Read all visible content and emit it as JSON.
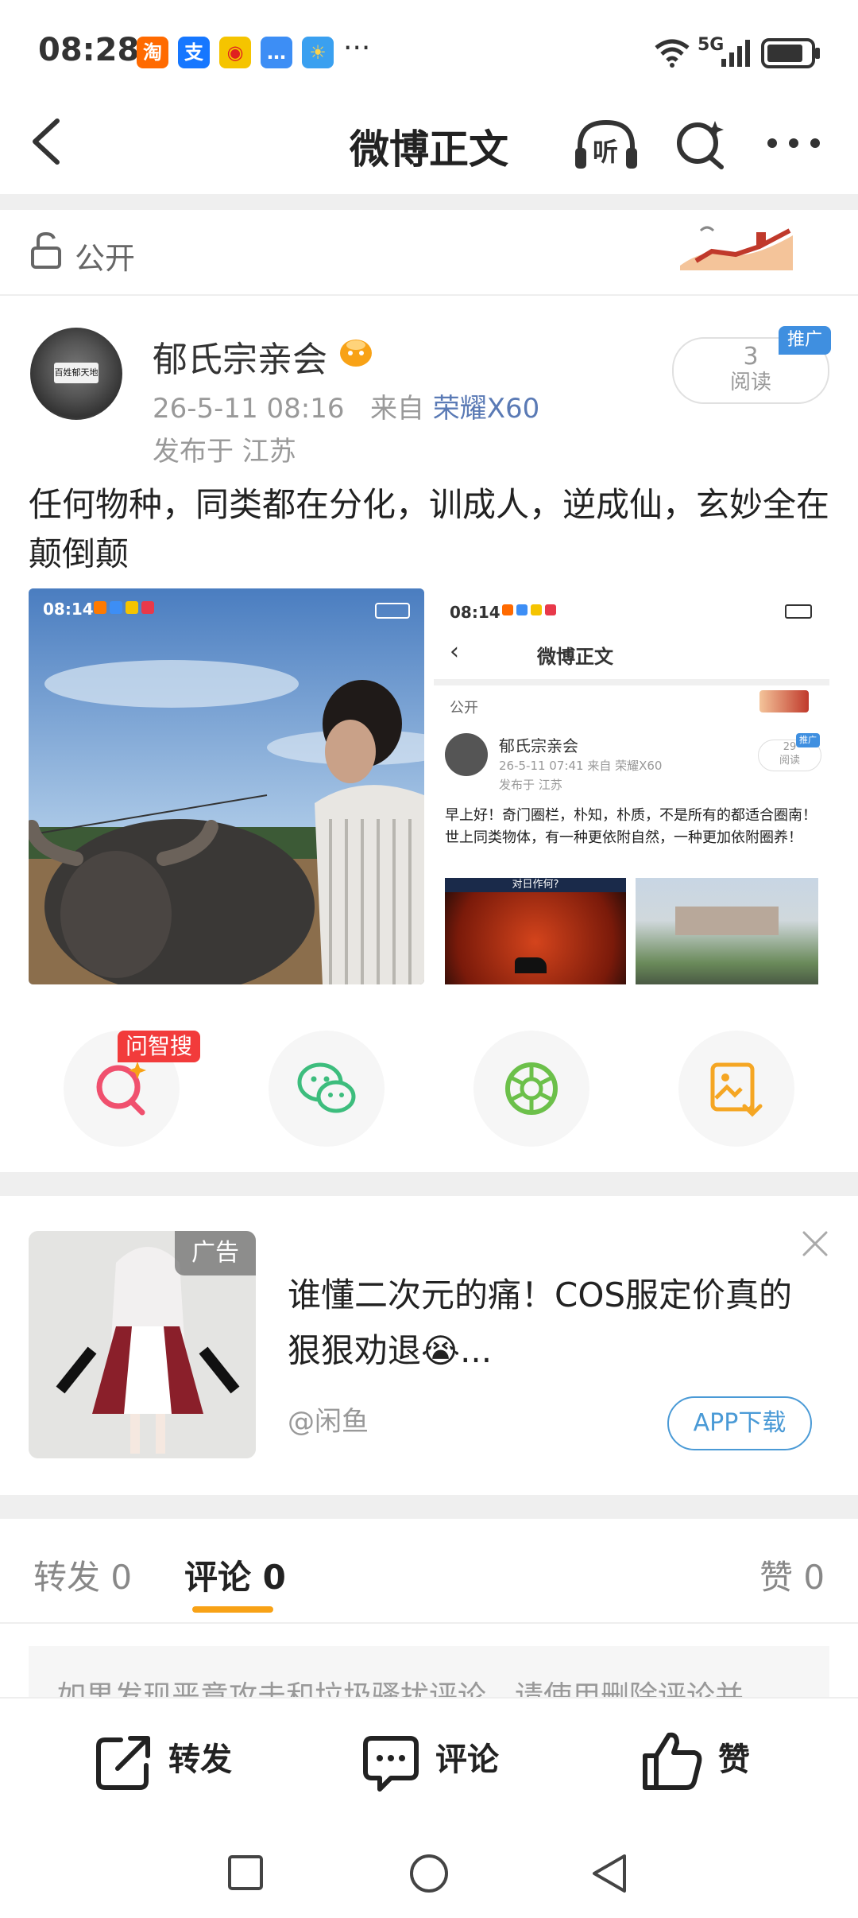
{
  "status_bar": {
    "time": "08:28",
    "app_icons": [
      {
        "name": "taobao-icon",
        "glyph": "淘",
        "color": "#ff6a00"
      },
      {
        "name": "alipay-icon",
        "glyph": "支",
        "color": "#1677ff"
      },
      {
        "name": "weibo-icon",
        "glyph": "微",
        "color": "#f5c400"
      },
      {
        "name": "message-icon",
        "glyph": "…",
        "color": "#3d8ef5"
      },
      {
        "name": "weather-icon",
        "glyph": "☀",
        "color": "#3aa0f0"
      }
    ],
    "more": "···",
    "network": "5G"
  },
  "navbar": {
    "title": "微博正文",
    "listen_label": "听"
  },
  "visibility": {
    "label": "公开"
  },
  "post": {
    "author": "郁氏宗亲会",
    "timestamp": "26-5-11 08:16",
    "source_prefix": "来自",
    "device": "荣耀X60",
    "location": "发布于 江苏",
    "read_count": "3",
    "read_label": "阅读",
    "promo_badge": "推广",
    "text": "任何物种，同类都在分化，训成人，逆成仙，玄妙全在颠倒颠",
    "avatar_text": "百姓郁天地"
  },
  "embedded_screenshot": {
    "time": "08:14",
    "title": "微博正文",
    "visibility": "公开",
    "author": "郁氏宗亲会",
    "timestamp": "26-5-11 07:41",
    "source": "来自 荣耀X60",
    "location": "发布于 江苏",
    "read_count": "29",
    "read_label": "阅读",
    "promo_badge": "推广",
    "text": "早上好！奇门圈栏，朴知，朴质，不是所有的都适合圈南！世上同类物体，有一种更依附自然，一种更加依附圈养！",
    "image_caption": "对日作何?"
  },
  "first_image_overlay": {
    "time": "08:14"
  },
  "share_actions": {
    "ask_badge": "问智搜",
    "items": [
      "smart-search",
      "wechat",
      "moments",
      "save-image"
    ]
  },
  "ad": {
    "tag": "广告",
    "title": "谁懂二次元的痛！COS服定价真的狠狠劝退😭...",
    "source": "@闲鱼",
    "button": "APP下载"
  },
  "tabs": {
    "repost": "转发 0",
    "comment": "评论 0",
    "like": "赞 0"
  },
  "comment_hint": "如果发现恶意攻击和垃圾骚扰评论，请使用删除评论并",
  "bottom_bar": {
    "repost": "转发",
    "comment": "评论",
    "like": "赞"
  },
  "colors": {
    "accent_orange": "#f8a216",
    "link_blue": "#5a7ab5",
    "badge_red": "#f23b3b",
    "promo_blue": "#3f8fe0"
  }
}
